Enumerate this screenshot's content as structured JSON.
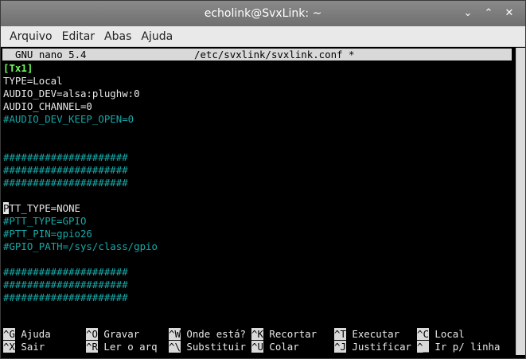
{
  "window": {
    "title": "echolink@SvxLink: ~",
    "controls": {
      "minimize": "⌄",
      "maximize": "⌃",
      "close": "✕"
    }
  },
  "menubar": [
    "Arquivo",
    "Editar",
    "Abas",
    "Ajuda"
  ],
  "nano": {
    "version": "GNU nano 5.4",
    "file": "/etc/svxlink/svxlink.conf *"
  },
  "editor": {
    "section": "[Tx1]",
    "line_type": "TYPE=Local",
    "line_audio_dev": "AUDIO_DEV=alsa:plughw:0",
    "line_audio_channel": "AUDIO_CHANNEL=0",
    "line_keep_open": "#AUDIO_DEV_KEEP_OPEN=0",
    "hashes": "#####################",
    "ptt_cursor_char": "P",
    "ptt_rest": "TT_TYPE=NONE",
    "ptt_type_gpio": "#PTT_TYPE=GPIO",
    "ptt_pin": "#PTT_PIN=gpio26",
    "gpio_path": "#GPIO_PATH=/sys/class/gpio"
  },
  "shortcuts": {
    "row1": [
      {
        "key": "^G",
        "label": "Ajuda"
      },
      {
        "key": "^O",
        "label": "Gravar"
      },
      {
        "key": "^W",
        "label": "Onde está?"
      },
      {
        "key": "^K",
        "label": "Recortar"
      },
      {
        "key": "^T",
        "label": "Executar"
      },
      {
        "key": "^C",
        "label": "Local"
      }
    ],
    "row2": [
      {
        "key": "^X",
        "label": "Sair"
      },
      {
        "key": "^R",
        "label": "Ler o arq"
      },
      {
        "key": "^\\",
        "label": "Substituir"
      },
      {
        "key": "^U",
        "label": "Colar"
      },
      {
        "key": "^J",
        "label": "Justificar"
      },
      {
        "key": "^_",
        "label": "Ir p/ linha"
      }
    ]
  },
  "colors": {
    "section": "#6bff58",
    "comment": "#17a8a8",
    "text": "#e8e8e8",
    "background": "#000000"
  }
}
